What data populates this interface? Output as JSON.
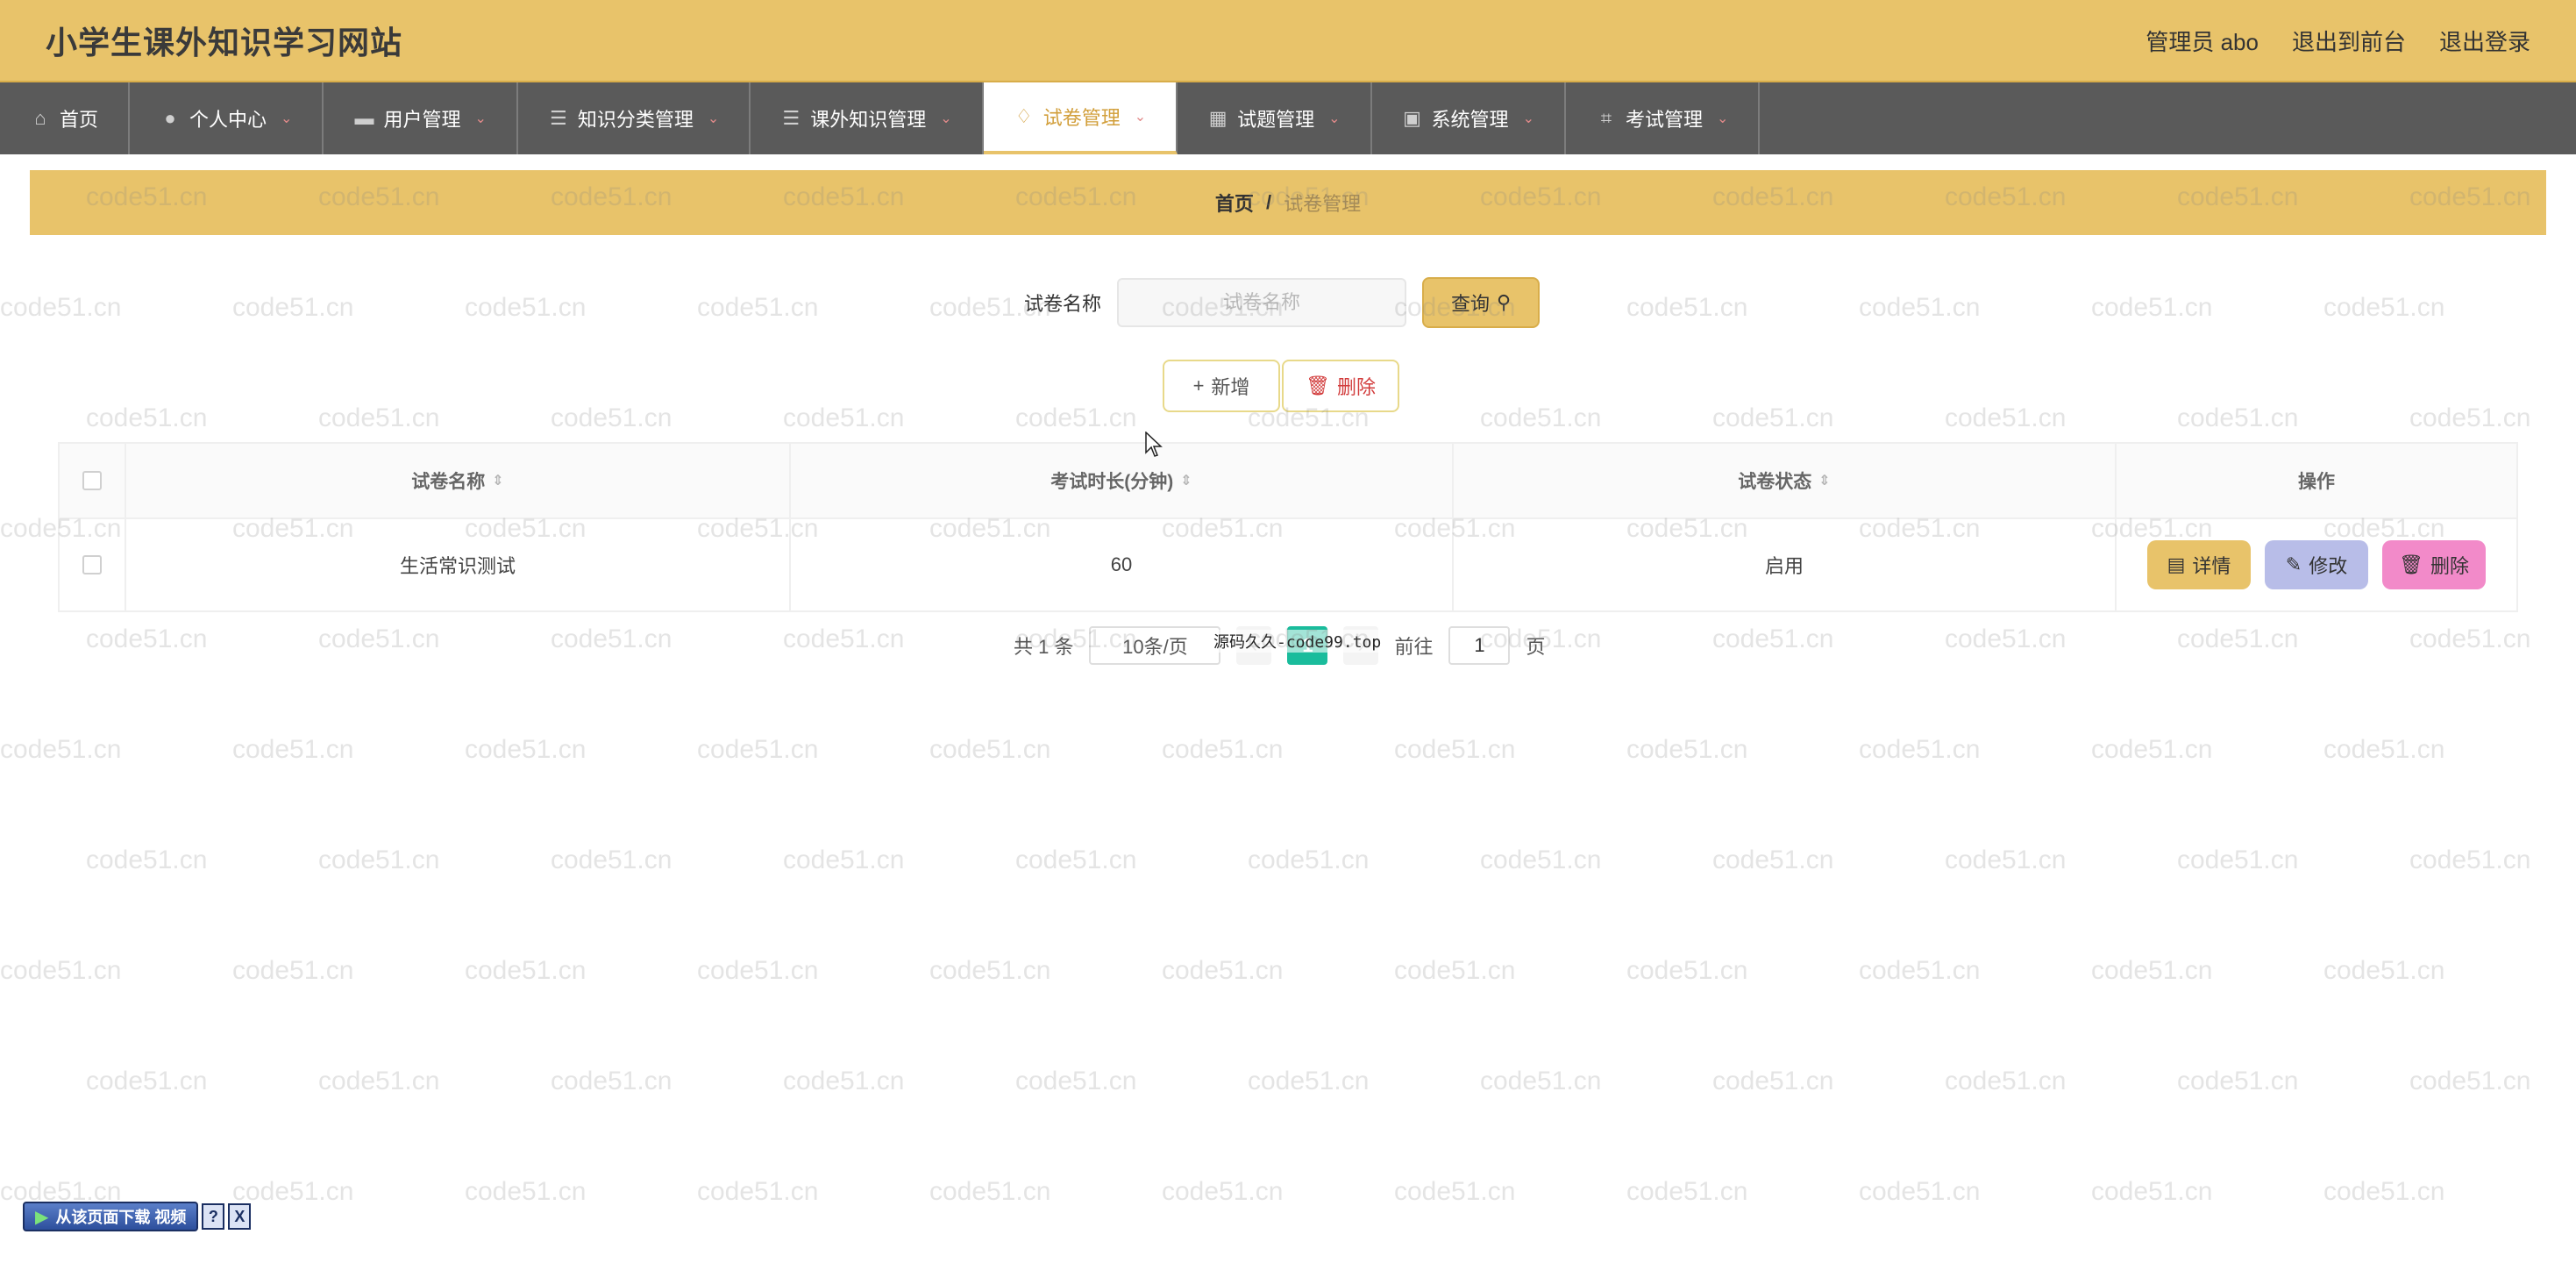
{
  "header": {
    "title": "小学生课外知识学习网站",
    "admin": "管理员 abo",
    "to_front": "退出到前台",
    "logout": "退出登录"
  },
  "nav": {
    "items": [
      {
        "label": "首页",
        "icon": "home-icon"
      },
      {
        "label": "个人中心",
        "icon": "user-icon"
      },
      {
        "label": "用户管理",
        "icon": "monitor-icon"
      },
      {
        "label": "知识分类管理",
        "icon": "list-icon"
      },
      {
        "label": "课外知识管理",
        "icon": "list-icon"
      },
      {
        "label": "试卷管理",
        "icon": "bell-icon",
        "active": true
      },
      {
        "label": "试题管理",
        "icon": "grid-icon"
      },
      {
        "label": "系统管理",
        "icon": "chart-icon"
      },
      {
        "label": "考试管理",
        "icon": "crop-icon"
      }
    ]
  },
  "breadcrumb": {
    "home": "首页",
    "separator": "/",
    "current": "试卷管理"
  },
  "search": {
    "label": "试卷名称",
    "placeholder": "试卷名称",
    "button": "查询"
  },
  "actions": {
    "add": "新增",
    "delete": "删除"
  },
  "table": {
    "headers": {
      "name": "试卷名称",
      "duration": "考试时长(分钟)",
      "status": "试卷状态",
      "ops": "操作"
    },
    "rows": [
      {
        "name": "生活常识测试",
        "duration": "60",
        "status": "启用"
      }
    ],
    "ops": {
      "detail": "详情",
      "edit": "修改",
      "delete": "删除"
    }
  },
  "pagination": {
    "total": "共 1 条",
    "page_size": "10条/页",
    "current_page": "1",
    "goto_label": "前往",
    "goto_value": "1",
    "goto_suffix": "页"
  },
  "overlay": "源码久久-code99.top",
  "watermark": "code51.cn",
  "widget": {
    "label": "从该页面下载 视频",
    "help": "?",
    "close": "X"
  }
}
